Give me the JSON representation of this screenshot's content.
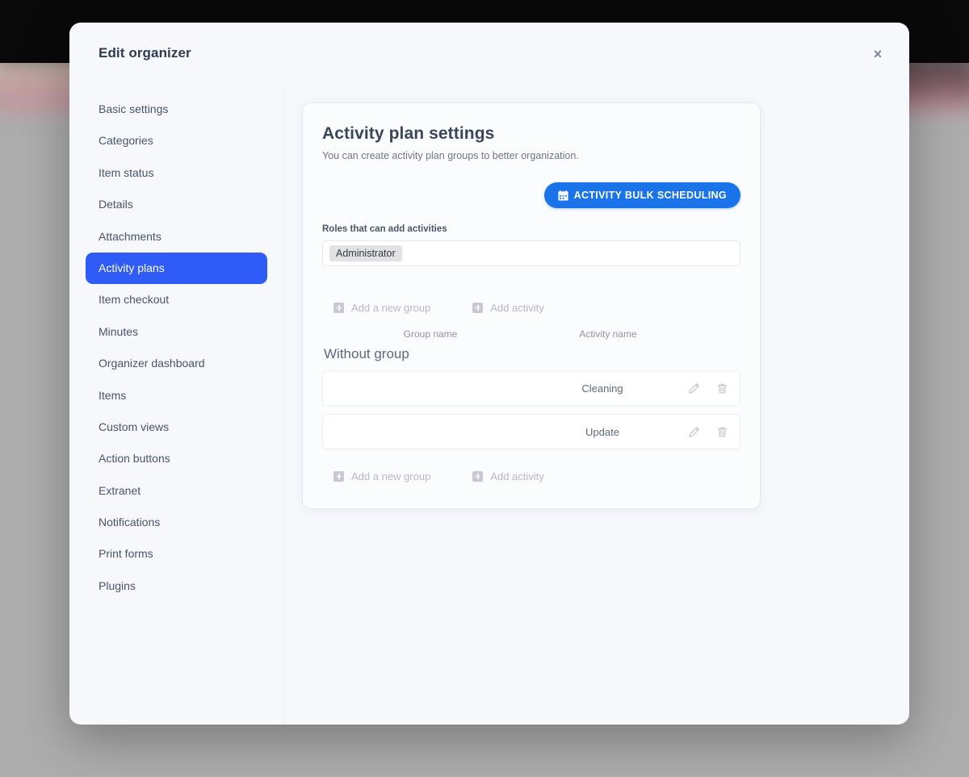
{
  "modal": {
    "title": "Edit organizer",
    "close_label": "×",
    "close_icon": "close-icon"
  },
  "sidebar": {
    "items": [
      {
        "label": "Basic settings",
        "active": false
      },
      {
        "label": "Categories",
        "active": false
      },
      {
        "label": "Item status",
        "active": false
      },
      {
        "label": "Details",
        "active": false
      },
      {
        "label": "Attachments",
        "active": false
      },
      {
        "label": "Activity plans",
        "active": true
      },
      {
        "label": "Item checkout",
        "active": false
      },
      {
        "label": "Minutes",
        "active": false
      },
      {
        "label": "Organizer dashboard",
        "active": false
      },
      {
        "label": "Items",
        "active": false
      },
      {
        "label": "Custom views",
        "active": false
      },
      {
        "label": "Action buttons",
        "active": false
      },
      {
        "label": "Extranet",
        "active": false
      },
      {
        "label": "Notifications",
        "active": false
      },
      {
        "label": "Print forms",
        "active": false
      },
      {
        "label": "Plugins",
        "active": false
      }
    ]
  },
  "card": {
    "title": "Activity plan settings",
    "subtitle": "You can create activity plan groups to better organization.",
    "bulk_button": {
      "label": "ACTIVITY BULK SCHEDULING",
      "icon": "calendar-icon",
      "color": "#1a73e8"
    },
    "roles_field": {
      "label": "Roles that can add activities",
      "chips": [
        "Administrator"
      ]
    },
    "add_actions_top": [
      {
        "label": "Add a new group",
        "icon": "plus-square-icon"
      },
      {
        "label": "Add activity",
        "icon": "plus-square-icon"
      }
    ],
    "columns": {
      "group_name": "Group name",
      "activity_name": "Activity name"
    },
    "group_label": "Without group",
    "rows": [
      {
        "group": "",
        "activity": "Cleaning",
        "edit_icon": "pencil-icon",
        "delete_icon": "trash-icon"
      },
      {
        "group": "",
        "activity": "Update",
        "edit_icon": "pencil-icon",
        "delete_icon": "trash-icon"
      }
    ],
    "add_actions_bottom": [
      {
        "label": "Add a new group",
        "icon": "plus-square-icon"
      },
      {
        "label": "Add activity",
        "icon": "plus-square-icon"
      }
    ]
  },
  "theme": {
    "accent": "#2f5bf6",
    "button_blue": "#1a73e8",
    "modal_bg": "#f7f8fc",
    "page_bg": "#b2b2b2"
  }
}
